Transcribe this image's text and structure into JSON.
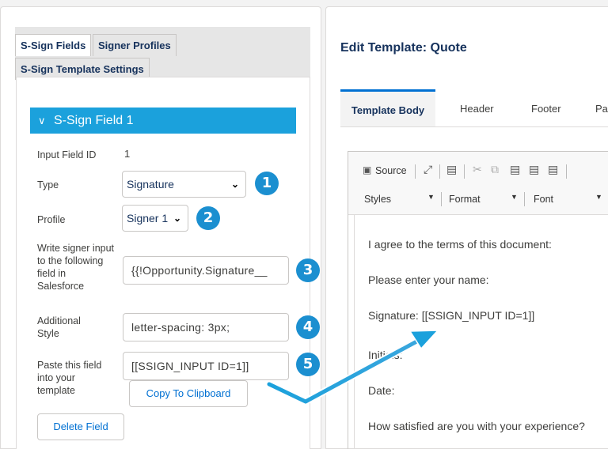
{
  "left": {
    "tabs": [
      "S-Sign Fields",
      "Signer Profiles",
      "S-Sign Template Settings"
    ],
    "section_title": "S-Sign Field 1",
    "input_field_id_label": "Input Field ID",
    "input_field_id_value": "1",
    "type_label": "Type",
    "type_value": "Signature",
    "profile_label": "Profile",
    "profile_value": "Signer 1",
    "write_label": "Write signer input to the following field in Salesforce",
    "write_value": "{{!Opportunity.Signature__",
    "style_label": "Additional Style",
    "style_value": "letter-spacing: 3px;",
    "paste_label": "Paste this field into your template",
    "paste_value": "[[SSIGN_INPUT ID=1]]",
    "copy_button": "Copy To Clipboard",
    "delete_button": "Delete Field",
    "badges": [
      "1",
      "2",
      "3",
      "4",
      "5"
    ]
  },
  "right": {
    "title": "Edit Template: Quote",
    "tabs": [
      "Template Body",
      "Header",
      "Footer",
      "Pa"
    ],
    "toolbar": {
      "source": "Source",
      "styles": "Styles",
      "format": "Format",
      "font": "Font"
    },
    "doc_lines": [
      "I agree to the terms of this document:",
      "Please enter your name:",
      "Signature: [[SSIGN_INPUT ID=1]]",
      "Initials:",
      "Date:",
      "How satisfied are you with your experience?"
    ]
  },
  "colors": {
    "accent": "#1ba1dc",
    "badge": "#1b8fd0",
    "link": "#0070d2"
  }
}
